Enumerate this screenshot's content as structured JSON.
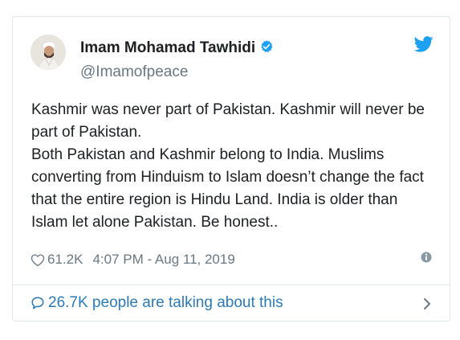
{
  "tweet": {
    "author": {
      "name": "Imam Mohamad Tawhidi",
      "handle": "@Imamofpeace",
      "verified": true
    },
    "text_lines": [
      "Kashmir was never part of Pakistan. Kashmir will never be part of Pakistan.",
      "Both Pakistan and Kashmir belong to India. Muslims converting from Hinduism to Islam doesn’t change the fact that the entire region is Hindu Land. India is older than Islam let alone Pakistan. Be honest.."
    ],
    "likes": "61.2K",
    "timestamp": "4:07 PM - Aug 11, 2019",
    "footer": {
      "talking_label": "26.7K people are talking about this"
    }
  },
  "colors": {
    "twitter_blue": "#1da1f2",
    "link_blue": "#2b7bb9",
    "muted": "#697882",
    "border": "#e1e8ed"
  },
  "icons": {
    "brand": "twitter-bird-icon",
    "verified": "verified-badge-icon",
    "like": "heart-icon",
    "info": "info-icon",
    "reply": "speech-bubble-icon",
    "more": "chevron-right-icon"
  }
}
